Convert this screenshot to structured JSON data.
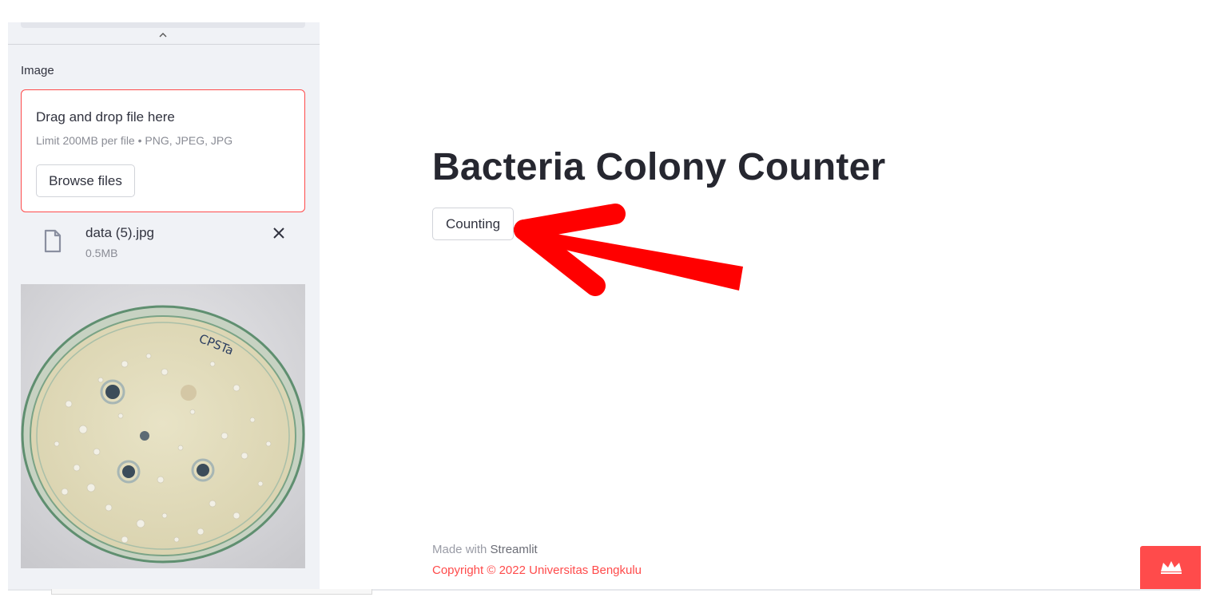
{
  "sidebar": {
    "collapse_icon": "chevron-up-icon",
    "uploader_label": "Image",
    "dropzone_title": "Drag and drop file here",
    "dropzone_limit": "Limit 200MB per file • PNG, JPEG, JPG",
    "browse_label": "Browse files",
    "file": {
      "name": "data (5).jpg",
      "size": "0.5MB",
      "icon": "file-icon",
      "remove_icon": "close-icon"
    },
    "preview_text": "CPSTa"
  },
  "main": {
    "title": "Bacteria Colony Counter",
    "counting_label": "Counting"
  },
  "footer": {
    "made_with": "Made with ",
    "brand": "Streamlit",
    "copyright": "Copyright © 2022 Universitas Bengkulu"
  },
  "colors": {
    "accent": "#ff4b4b",
    "sidebar_bg": "#f0f2f6",
    "annotation_arrow": "#ff0000"
  }
}
